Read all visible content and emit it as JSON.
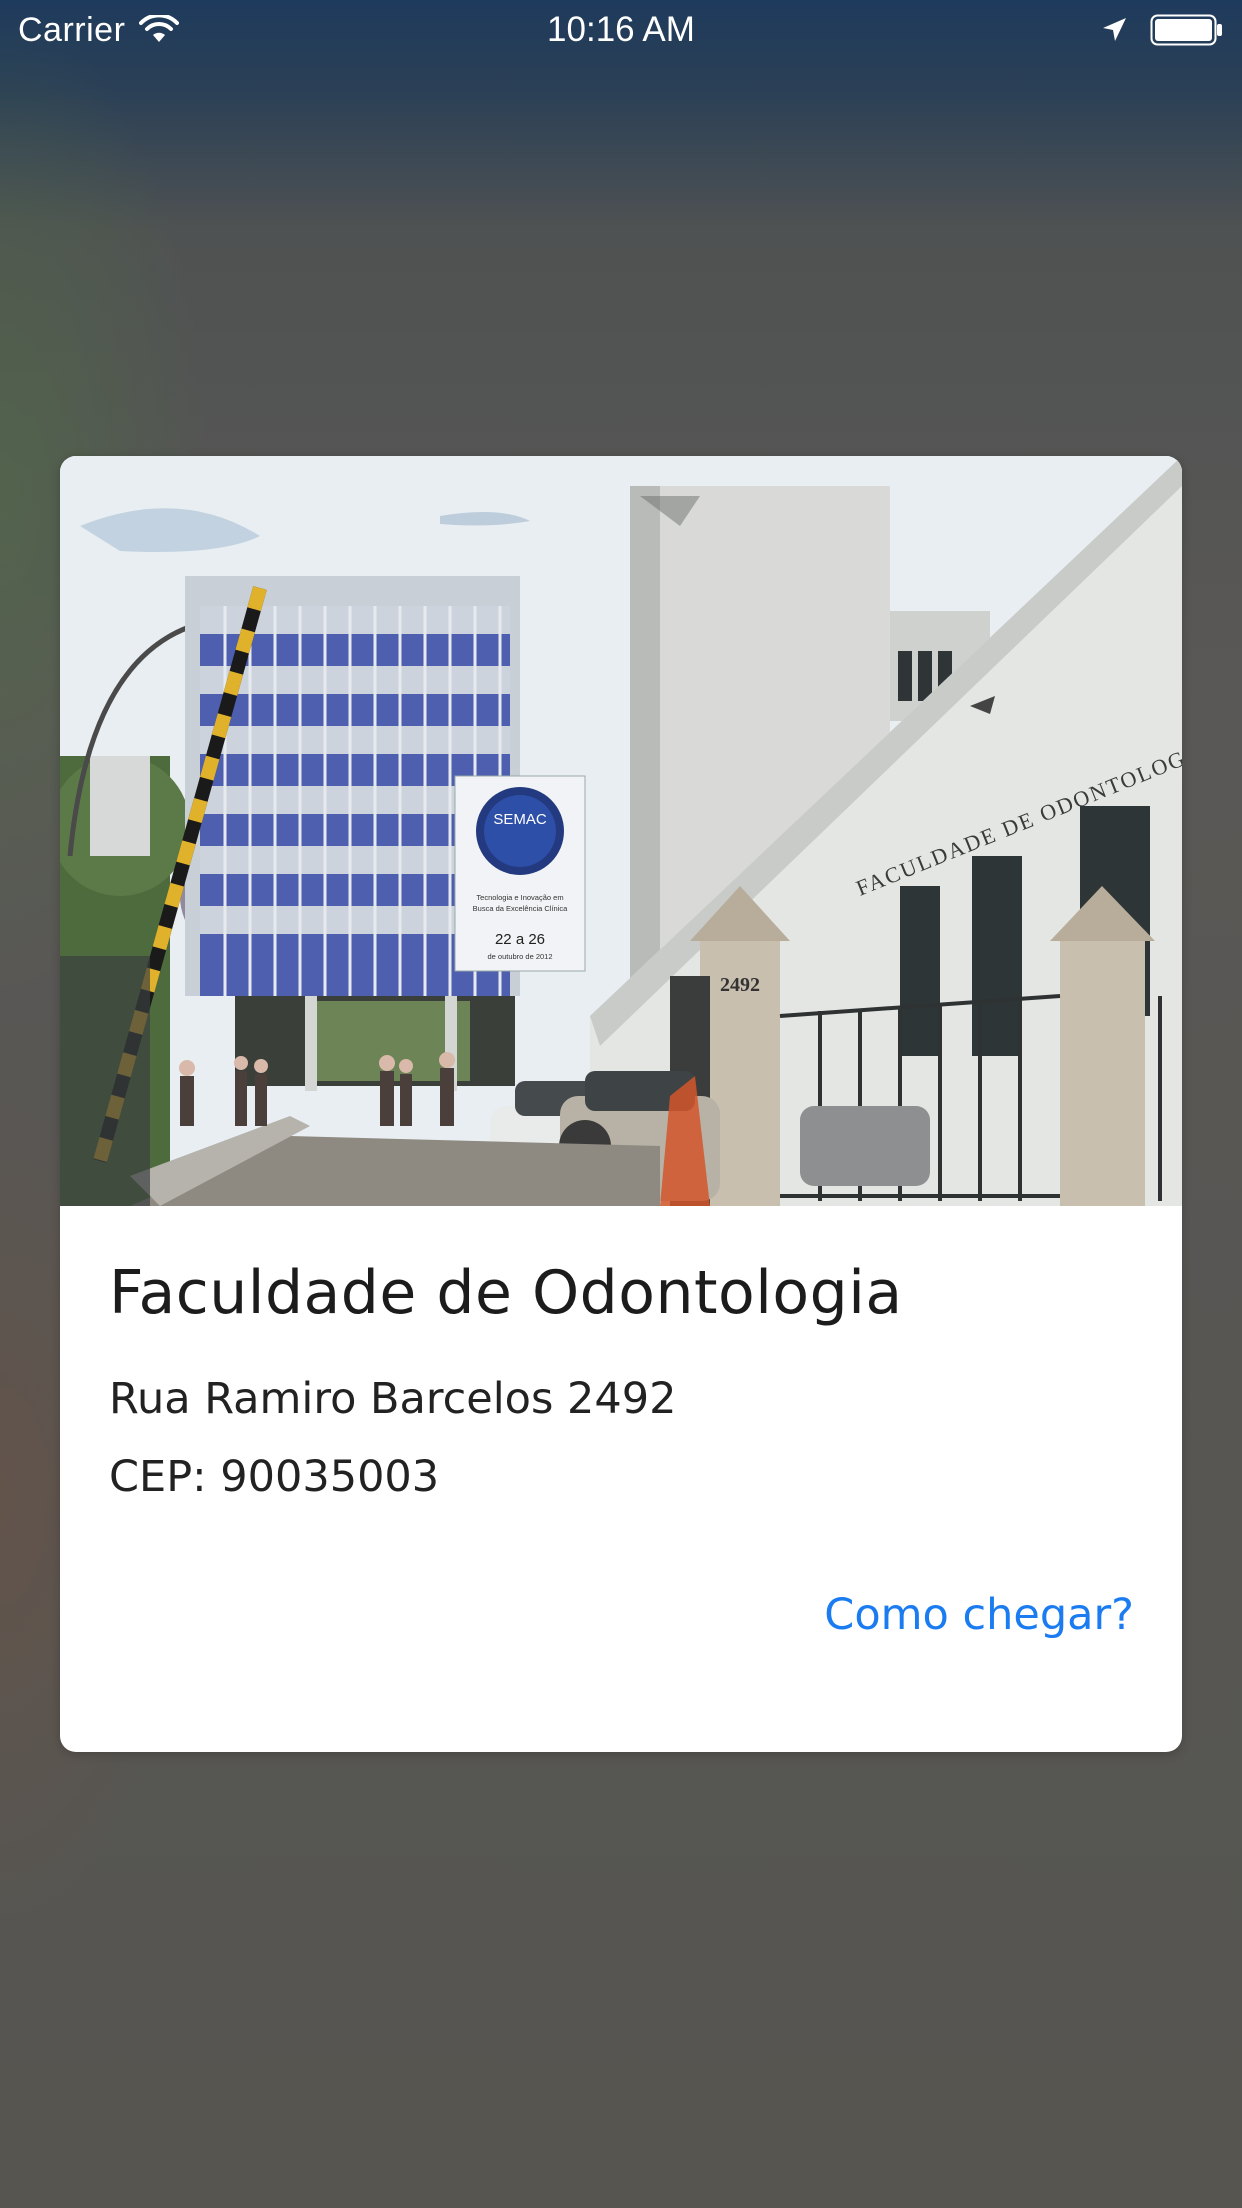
{
  "status_bar": {
    "carrier": "Carrier",
    "time": "10:16 AM",
    "icons": [
      "wifi-icon",
      "location-arrow-icon",
      "battery-icon"
    ]
  },
  "card": {
    "photo": {
      "subject": "building-photo",
      "banner_title": "SEMAC",
      "banner_line1": "Tecnologia e Inovação em",
      "banner_line2": "Busca da Excelência Clínica",
      "banner_dates": "22 a 26",
      "banner_month": "de outubro de 2012",
      "facade_sign": "FACULDADE DE ODONTOLOGIA UFRGS",
      "street_number": "2492"
    },
    "title": "Faculdade de Odontologia",
    "address": "Rua Ramiro Barcelos 2492",
    "cep": "CEP: 90035003",
    "directions_label": "Como chegar?"
  },
  "colors": {
    "link": "#1a7cf0",
    "card_background": "#ffffff",
    "status_bar_top": "#1e3a5c"
  }
}
